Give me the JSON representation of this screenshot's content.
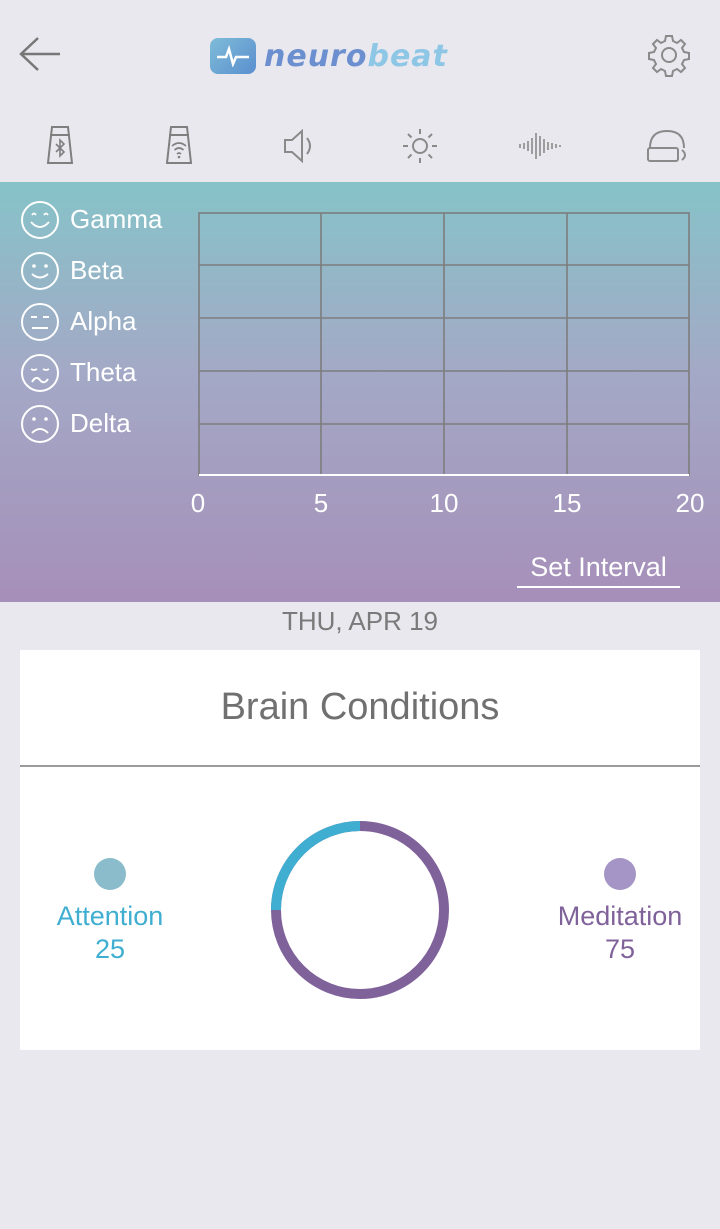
{
  "header": {
    "back_icon": "arrow-left-icon",
    "logo_text_part1": "neuro",
    "logo_text_part2": "beat",
    "settings_icon": "gear-icon"
  },
  "toolbar": {
    "items": [
      {
        "icon": "bluetooth-device-icon"
      },
      {
        "icon": "wifi-device-icon"
      },
      {
        "icon": "speaker-icon"
      },
      {
        "icon": "brightness-icon"
      },
      {
        "icon": "waveform-icon"
      },
      {
        "icon": "headset-icon"
      }
    ]
  },
  "graph": {
    "legend": [
      {
        "label": "Gamma",
        "icon": "very-happy-face-icon"
      },
      {
        "label": "Beta",
        "icon": "happy-face-icon"
      },
      {
        "label": "Alpha",
        "icon": "neutral-face-icon"
      },
      {
        "label": "Theta",
        "icon": "sad-face-icon"
      },
      {
        "label": "Delta",
        "icon": "very-sad-face-icon"
      }
    ],
    "x_ticks": [
      "0",
      "5",
      "10",
      "15",
      "20"
    ],
    "set_interval_label": "Set Interval",
    "colors": {
      "grid": "#7d7d7d",
      "top": "#86c3c8",
      "bottom": "#a68fb9"
    }
  },
  "date_label": "THU, APR 19",
  "brain_conditions": {
    "title": "Brain Conditions",
    "attention": {
      "label": "Attention",
      "value": "25",
      "color": "#3faed1",
      "dot_color": "#8bbccb"
    },
    "meditation": {
      "label": "Meditation",
      "value": "75",
      "color": "#80629b",
      "dot_color": "#a594c6"
    },
    "ring": {
      "attention_fraction": 0.25,
      "meditation_fraction": 0.75
    }
  }
}
